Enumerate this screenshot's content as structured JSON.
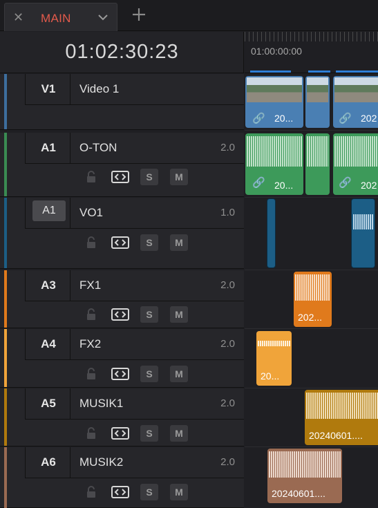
{
  "tabs": [
    {
      "label": "MAIN"
    }
  ],
  "timecode": "01:02:30:23",
  "ruler": {
    "start": "01:00:00:00"
  },
  "colors": {
    "accent": "#2f7fd6",
    "tab_active": "#e35a4b"
  },
  "tracks": [
    {
      "id": "V1",
      "name": "Video 1",
      "level": "",
      "color": "#3d6e9e",
      "controls": [
        "lock",
        "auto-select",
        "video-toggle"
      ]
    },
    {
      "id": "A1",
      "name": "O-TON",
      "level": "2.0",
      "color": "#3a8b52",
      "controls": [
        "lock",
        "auto-select",
        "S",
        "M"
      ]
    },
    {
      "id": "A1",
      "name": "VO1",
      "level": "1.0",
      "color": "#1c5e86",
      "controls": [
        "lock",
        "auto-select",
        "S",
        "M"
      ],
      "id_boxed": true
    },
    {
      "id": "A3",
      "name": "FX1",
      "level": "2.0",
      "color": "#e07a1c",
      "controls": [
        "lock",
        "auto-select",
        "S",
        "M"
      ]
    },
    {
      "id": "A4",
      "name": "FX2",
      "level": "2.0",
      "color": "#f0a43a",
      "controls": [
        "lock",
        "auto-select",
        "S",
        "M"
      ]
    },
    {
      "id": "A5",
      "name": "MUSIK1",
      "level": "2.0",
      "color": "#b07a0d",
      "controls": [
        "lock",
        "auto-select",
        "S",
        "M"
      ]
    },
    {
      "id": "A6",
      "name": "MUSIK2",
      "level": "2.0",
      "color": "#9a6a52",
      "controls": [
        "lock",
        "auto-select",
        "S",
        "M"
      ]
    }
  ],
  "clips": {
    "v1": [
      "20...",
      "",
      "202"
    ],
    "a1": [
      "20...",
      "",
      "202"
    ],
    "a3": "202...",
    "a4": "20...",
    "a5": "20240601....",
    "a6": "20240601...."
  },
  "buttons": {
    "solo": "S",
    "mute": "M"
  }
}
